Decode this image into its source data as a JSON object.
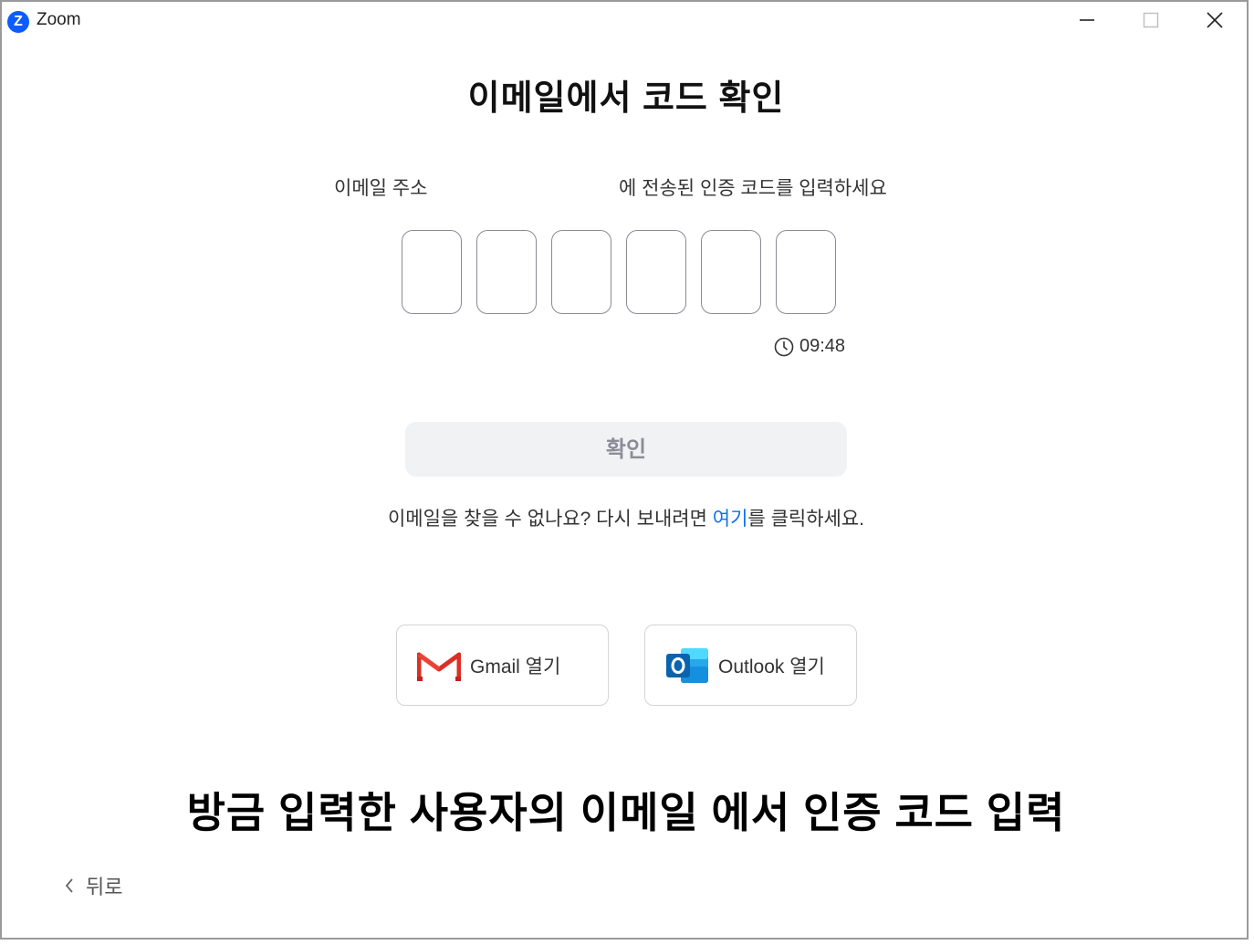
{
  "window": {
    "app_name": "Zoom",
    "logo_letter": "Z",
    "brand_color": "#0b5cff"
  },
  "page": {
    "heading": "이메일에서 코드 확인",
    "subtitle_left": "이메일 주소",
    "subtitle_right": "에 전송된 인증 코드를 입력하세요",
    "code_boxes": [
      "",
      "",
      "",
      "",
      "",
      ""
    ],
    "timer": "09:48",
    "confirm_label": "확인",
    "help": {
      "prefix": "이메일을 찾을 수 없나요? 다시 보내려면 ",
      "link": "여기",
      "suffix": "를 클릭하세요."
    },
    "gmail_label": "Gmail 열기",
    "outlook_label": "Outlook 열기",
    "caption": "방금 입력한 사용자의 이메일 에서 인증 코드 입력",
    "back_label": "뒤로",
    "link_color": "#0e72ed"
  }
}
